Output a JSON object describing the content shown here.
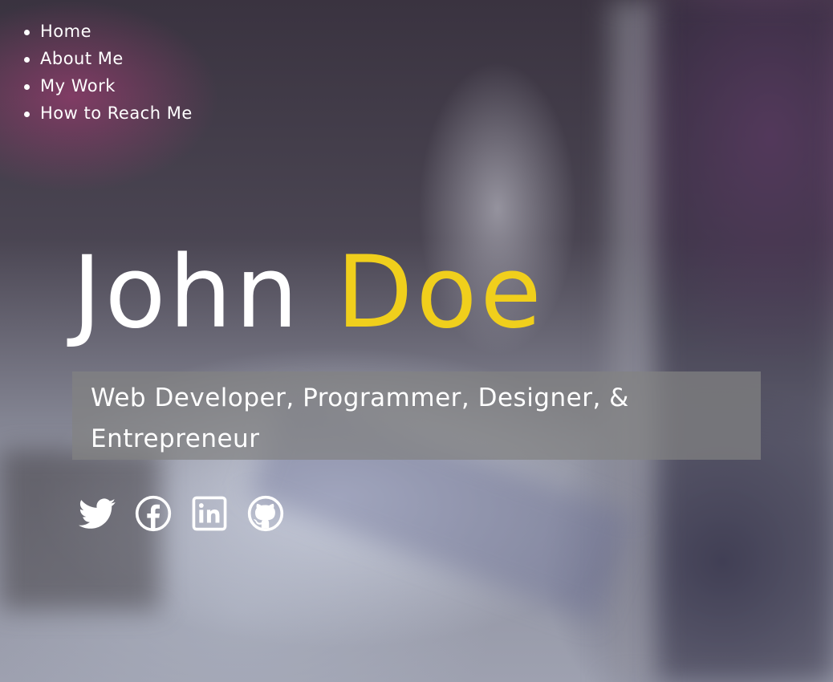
{
  "nav": {
    "items": [
      {
        "label": "Home"
      },
      {
        "label": "About Me"
      },
      {
        "label": "My Work"
      },
      {
        "label": "How to Reach Me"
      }
    ]
  },
  "hero": {
    "first_name": "John",
    "last_name": "Doe",
    "tagline": "Web Developer, Programmer, Designer, & Entrepreneur"
  },
  "social": [
    {
      "icon": "twitter-icon"
    },
    {
      "icon": "facebook-icon"
    },
    {
      "icon": "linkedin-icon"
    },
    {
      "icon": "github-icon"
    }
  ],
  "colors": {
    "accent": "#f0cf1c",
    "text": "#ffffff",
    "tagline_bg": "#828282"
  }
}
